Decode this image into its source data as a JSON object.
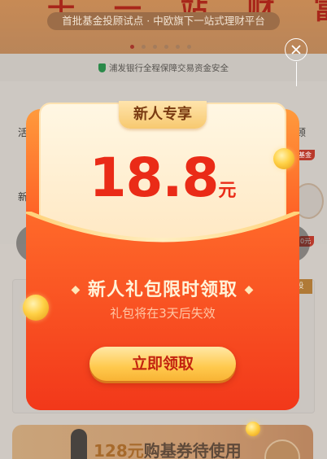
{
  "background": {
    "banner_big": "十 一 站 财 富",
    "banner_sub": "首批基金投顾试点 · 中欧旗下一站式理财平台",
    "safety_text": "浦发银行全程保障交易资金安全",
    "grid_labels": {
      "left_top": "活期",
      "right_top": "投顾",
      "left_bottom": "新"
    },
    "side_badges": {
      "fund": "基金",
      "amount": "0元"
    },
    "card_tag": "投",
    "promo": {
      "amount": "128元",
      "text": "购基券待使用"
    }
  },
  "modal": {
    "tag": "新人专享",
    "amount": "18.8",
    "unit": "元",
    "headline": "新人礼包限时领取",
    "subline": "礼包将在3天后失效",
    "cta": "立即领取",
    "colors": {
      "envelope": "#f6421c",
      "amount": "#ea2b17",
      "cta": "#ffc94d"
    }
  },
  "icons": {
    "close": "close-icon",
    "prev": "chevron-left-icon",
    "next": "chevron-right-icon",
    "safety": "shield-icon"
  }
}
